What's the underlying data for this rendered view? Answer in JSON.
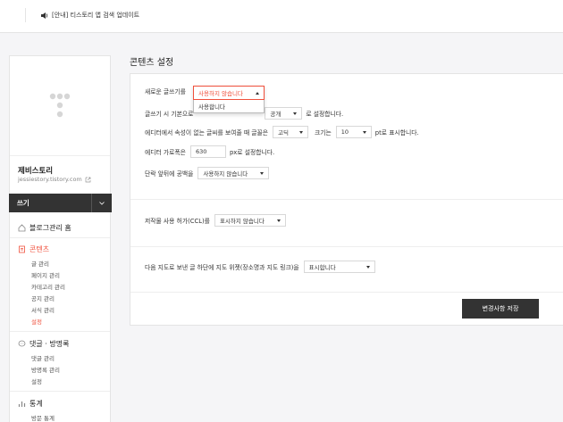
{
  "topbar": {
    "notice": "[안내] 티스토리 앱 검색 업데이트"
  },
  "sidebar": {
    "blog_name": "제비스토리",
    "blog_url": "jessiestory.tistory.com",
    "write_label": "쓰기",
    "home_label": "블로그관리 홈",
    "contents": {
      "label": "콘텐츠",
      "items": [
        "글 관리",
        "페이지 관리",
        "카테고리 관리",
        "공지 관리",
        "서식 관리",
        "설정"
      ]
    },
    "comments": {
      "label": "댓글 · 방명록",
      "items": [
        "댓글 관리",
        "방명록 관리",
        "설정"
      ]
    },
    "stats": {
      "label": "통계",
      "items": [
        "방문 통계"
      ]
    }
  },
  "main": {
    "title": "콘텐츠 설정",
    "new_post_label": "새로운 글쓰기를",
    "new_post_value": "사용하지 않습니다",
    "new_post_options": [
      "사용합니다"
    ],
    "default_visibility_prefix": "글쓰기 시 기본으로",
    "default_visibility_value": "공개",
    "default_visibility_suffix": "로 설정합니다.",
    "font_label_prefix": "에디터에서 속성이 없는 글씨를 보여줄 때 글꼴은",
    "font_value": "고딕",
    "font_size_label": "크기는",
    "font_size_value": "10",
    "font_size_suffix": "pt로 표시합니다.",
    "width_label": "에디터 가로폭은",
    "width_value": "630",
    "width_suffix": "px로 설정합니다.",
    "paragraph_label": "단락 앞뒤에 공백을",
    "paragraph_value": "사용하지 않습니다",
    "ccl_label": "저작물 사용 허가(CCL)를",
    "ccl_value": "표시하지 않습니다",
    "map_label": "다음 지도로 보낸 글 하단에 지도 위젯(장소명과 지도 링크)을",
    "map_value": "표시합니다",
    "save_label": "변경사항 저장"
  },
  "colors": {
    "accent": "#f0503c",
    "dark": "#333333"
  }
}
